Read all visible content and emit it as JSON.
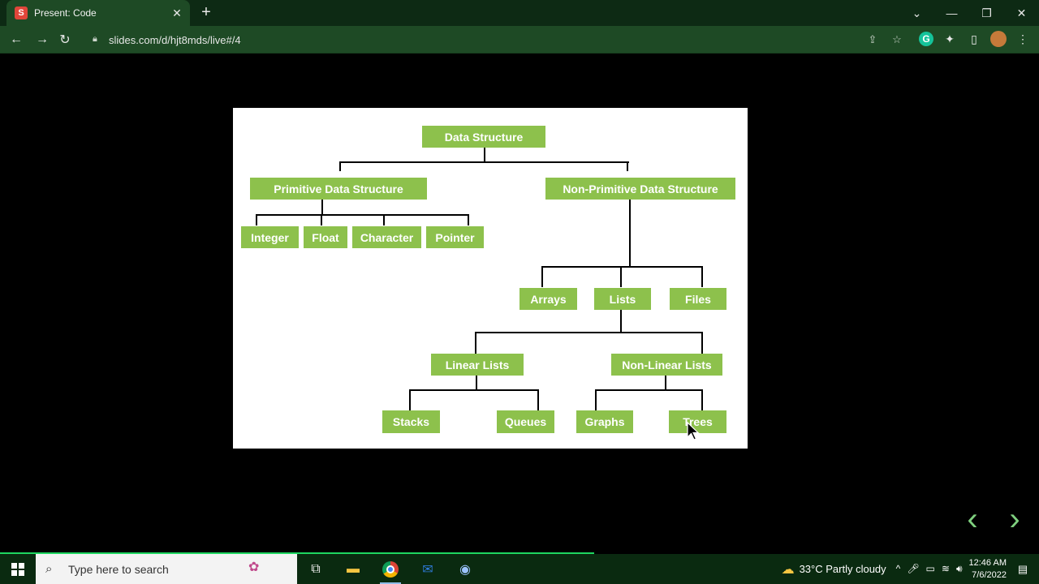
{
  "browser": {
    "tab_title": "Present: Code",
    "tab_favicon": "S",
    "url": "slides.com/d/hjt8mds/live#/4",
    "accent_color": "#1e4a25"
  },
  "slide": {
    "nodes": {
      "root": "Data Structure",
      "primitive": "Primitive Data Structure",
      "non_primitive": "Non-Primitive Data Structure",
      "integer": "Integer",
      "float": "Float",
      "character": "Character",
      "pointer": "Pointer",
      "arrays": "Arrays",
      "lists": "Lists",
      "files": "Files",
      "linear_lists": "Linear Lists",
      "non_linear_lists": "Non-Linear Lists",
      "stacks": "Stacks",
      "queues": "Queues",
      "graphs": "Graphs",
      "trees": "Trees"
    },
    "node_color": "#8dc14c"
  },
  "taskbar": {
    "search_placeholder": "Type here to search",
    "weather": "33°C  Partly cloudy",
    "time": "12:46 AM",
    "date": "7/6/2022"
  }
}
